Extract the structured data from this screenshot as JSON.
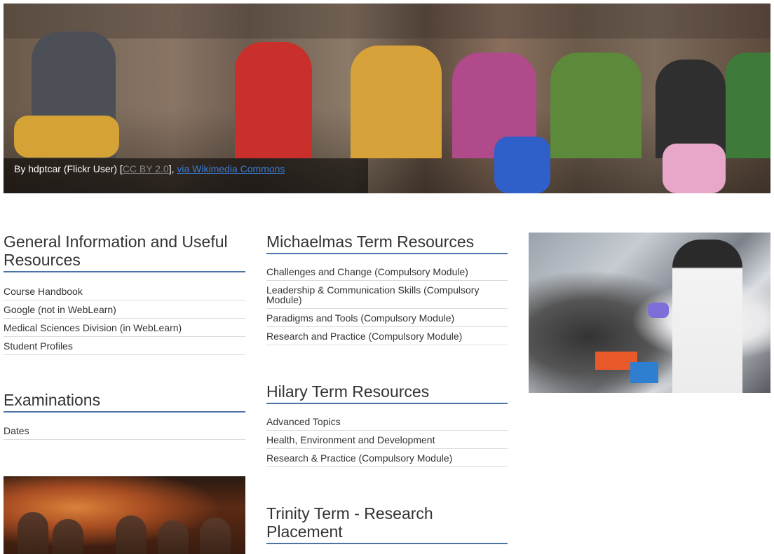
{
  "hero": {
    "caption_prefix": "By hdptcar (Flickr User) [",
    "license_link": "CC BY 2.0",
    "caption_mid": "], ",
    "source_link": "via Wikimedia Commons"
  },
  "general": {
    "title": "General Information and Useful Resources",
    "items": [
      "Course Handbook",
      "Google (not in WebLearn)",
      "Medical Sciences Division (in WebLearn)",
      "Student Profiles"
    ]
  },
  "examinations": {
    "title": "Examinations",
    "items": [
      "Dates"
    ]
  },
  "michaelmas": {
    "title": "Michaelmas Term Resources",
    "items": [
      "Challenges and Change (Compulsory Module)",
      "Leadership & Communication Skills (Compulsory Module)",
      "Paradigms and Tools (Compulsory Module)",
      "Research and Practice (Compulsory Module)"
    ]
  },
  "hilary": {
    "title": "Hilary Term Resources",
    "items": [
      "Advanced Topics",
      "Health, Environment and Development",
      "Research & Practice (Compulsory Module)"
    ]
  },
  "trinity": {
    "title": "Trinity Term - Research Placement"
  }
}
